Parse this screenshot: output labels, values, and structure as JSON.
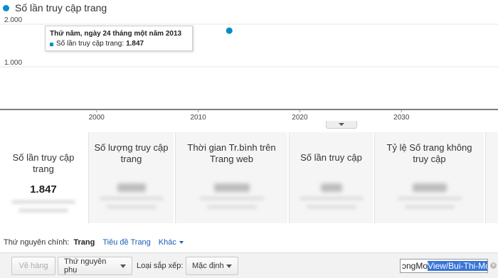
{
  "legend": {
    "label": "Số lần truy cập trang",
    "color": "#058dc7"
  },
  "chart_data": {
    "type": "scatter",
    "series": [
      {
        "name": "Số lần truy cập trang",
        "points": [
          {
            "x": 2013.06,
            "y": 1847
          }
        ]
      }
    ],
    "xticks": [
      "2000",
      "2010",
      "2020",
      "2030"
    ],
    "xtick_values": [
      2000,
      2010,
      2020,
      2030
    ],
    "yticks": [
      "2.000",
      "1.000"
    ],
    "ytick_values": [
      2000,
      1000
    ],
    "xlim": [
      1990.5,
      2039.5
    ],
    "ylim": [
      0,
      2000
    ],
    "grid": true
  },
  "tooltip": {
    "title": "Thứ năm, ngày 24 tháng một năm 2013",
    "metric_label": "Số lần truy cập trang:",
    "metric_value": "1.847"
  },
  "metrics": [
    {
      "title": "Số lần truy cập trang",
      "value": "1.847",
      "selected": true
    },
    {
      "title": "Số lượng truy cập trang",
      "value": "",
      "selected": false
    },
    {
      "title": "Thời gian Tr.bình trên Trang web",
      "value": "",
      "selected": false
    },
    {
      "title": "Số lần truy cập",
      "value": "",
      "selected": false
    },
    {
      "title": "Tỷ lệ Số trang không truy cập",
      "value": "",
      "selected": false
    }
  ],
  "dimensions": {
    "label": "Thứ nguyên chính:",
    "active": "Trang",
    "link": "Tiêu đề Trang",
    "more": "Khác"
  },
  "toolbar": {
    "add_row_label": "Vẽ hàng",
    "secondary_dimension_label": "Thứ nguyên phụ",
    "sort_type_label": "Loại sắp xếp:",
    "sort_value": "Mặc định",
    "search_value_prefix": "ɔngMo",
    "search_value_selected": "View/Bui-Thi-Mo"
  }
}
